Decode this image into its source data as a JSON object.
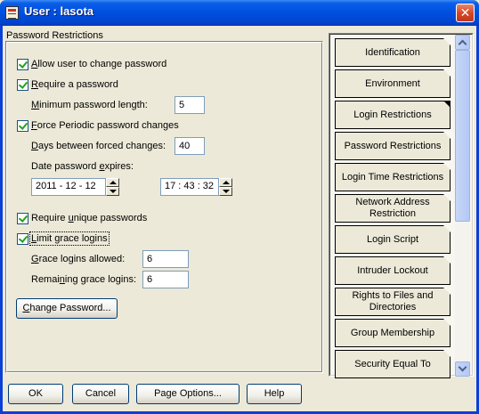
{
  "window": {
    "title": "User : lasota",
    "close_glyph": "✕"
  },
  "group": {
    "title": "Password Restrictions"
  },
  "options": {
    "allow_change": {
      "pre": "",
      "key": "A",
      "post": "llow user to change password",
      "checked": true
    },
    "require_password": {
      "pre": "",
      "key": "R",
      "post": "equire a password",
      "checked": true
    },
    "min_length": {
      "pre": "",
      "key": "M",
      "post": "inimum password length:",
      "value": "5"
    },
    "force_periodic": {
      "pre": "",
      "key": "F",
      "post": "orce Periodic password changes",
      "checked": true
    },
    "days_between": {
      "pre": "",
      "key": "D",
      "post": "ays between forced changes:",
      "value": "40"
    },
    "expires": {
      "pre": "Date password ",
      "key": "e",
      "post": "xpires:",
      "date": "2011  -  12 - 12",
      "time": "17 : 43 : 32"
    },
    "unique": {
      "pre": "Require ",
      "key": "u",
      "post": "nique passwords",
      "checked": true
    },
    "grace": {
      "pre": "",
      "key": "L",
      "post": "imit grace logins",
      "checked": true
    },
    "grace_allowed": {
      "pre": "",
      "key": "G",
      "post": "race logins allowed:",
      "value": "6"
    },
    "grace_remaining": {
      "pre": "Remai",
      "key": "n",
      "post": "ing grace logins:",
      "value": "6"
    }
  },
  "change_password": {
    "pre": "",
    "key": "C",
    "post": "hange Password..."
  },
  "tabs": [
    {
      "label": "Identification",
      "active": false
    },
    {
      "label": "Environment",
      "active": false
    },
    {
      "label": "Login Restrictions",
      "active": true
    },
    {
      "label": "Password Restrictions",
      "active": false
    },
    {
      "label": "Login Time Restrictions",
      "active": false
    },
    {
      "label": "Network Address Restriction",
      "active": false
    },
    {
      "label": "Login Script",
      "active": false
    },
    {
      "label": "Intruder Lockout",
      "active": false
    },
    {
      "label": "Rights to Files and Directories",
      "active": false
    },
    {
      "label": "Group Membership",
      "active": false
    },
    {
      "label": "Security Equal To",
      "active": false
    }
  ],
  "buttons": {
    "ok": "OK",
    "cancel": "Cancel",
    "page_options": "Page Options...",
    "help": "Help"
  },
  "icons": {
    "window_icon": "user-dialog-icon",
    "scroll_up": "chevron-up-icon",
    "scroll_down": "chevron-down-icon"
  },
  "colors": {
    "titlebar": "#0050e0",
    "face": "#ece9d8",
    "close": "#d4492a"
  }
}
